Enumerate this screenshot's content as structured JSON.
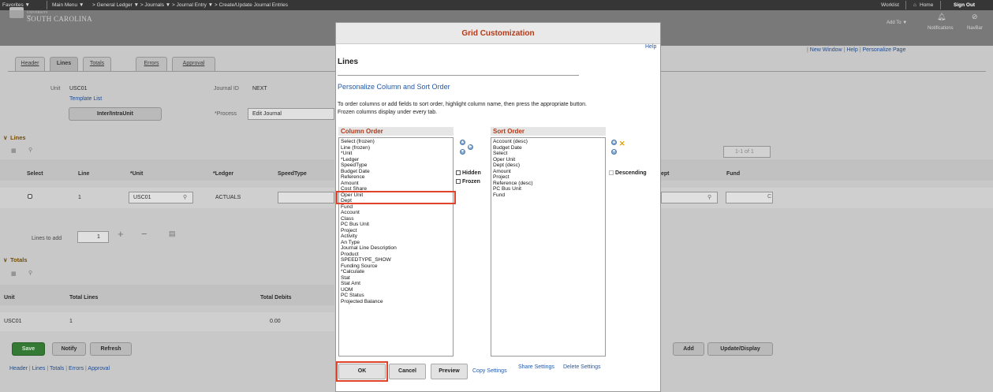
{
  "topbar": {
    "favorites": "Favorites ▼",
    "main_menu": "Main Menu ▼",
    "crumbs": "> General Ledger ▼ > Journals ▼ > Journal Entry ▼ > Create/Update Journal Entries",
    "worklist": "Worklist",
    "home": "Home",
    "signout": "Sign Out"
  },
  "header": {
    "logo_top": "UNIVERSITY OF",
    "logo_main": "SOUTH CAROLINA",
    "add_to": "Add To ▼",
    "notifications": "Notifications",
    "navbar": "NavBar",
    "links": [
      "New Window",
      "Help",
      "Personalize Page"
    ]
  },
  "tabs": [
    "Header",
    "Lines",
    "Totals",
    "Errors",
    "Approval"
  ],
  "form": {
    "unit_label": "Unit",
    "unit_value": "USC01",
    "template_list": "Template List",
    "interunit_btn": "Inter/IntraUnit",
    "journal_id_label": "Journal ID",
    "journal_id_value": "NEXT",
    "process_label": "*Process",
    "process_value": "Edit Journal"
  },
  "lines": {
    "section": "Lines",
    "pager": "1-1 of 1",
    "columns": [
      "Select",
      "Line",
      "*Unit",
      "*Ledger",
      "SpeedType"
    ],
    "right_columns": [
      "ept",
      "Fund"
    ],
    "row": {
      "line": "1",
      "unit": "USC01",
      "ledger": "ACTUALS"
    },
    "lines_to_add_label": "Lines to add",
    "lines_to_add_value": "1"
  },
  "totals": {
    "section": "Totals",
    "columns": [
      "Unit",
      "Total Lines",
      "Total Debits"
    ],
    "row": {
      "unit": "USC01",
      "lines": "1",
      "debits": "0.00"
    }
  },
  "bottom_buttons": [
    "Save",
    "Notify",
    "Refresh"
  ],
  "right_buttons": [
    "Add",
    "Update/Display"
  ],
  "bottom_links": [
    "Header",
    "Lines",
    "Totals",
    "Errors",
    "Approval"
  ],
  "modal": {
    "title": "Grid Customization",
    "help": "Help",
    "heading": "Lines",
    "subheading": "Personalize Column and Sort Order",
    "instructions_1": "To order columns or add fields to sort order, highlight column name, then press the appropriate button.",
    "instructions_2": "Frozen columns display under every tab.",
    "column_order_label": "Column Order",
    "sort_order_label": "Sort Order",
    "column_order_items": [
      "Select (frozen)",
      "Line (frozen)",
      "*Unit",
      "*Ledger",
      "SpeedType",
      "Budget Date",
      "Reference",
      "Amount",
      "Cost Share",
      "Oper Unit",
      "Dept",
      "Fund",
      "Account",
      "Class",
      "PC Bus Unit",
      "Project",
      "Activity",
      "An Type",
      "Journal Line Description",
      "Product",
      "SPEEDTYPE_SHOW",
      "Funding Source",
      "*Calculate",
      "Stat",
      "Stat Amt",
      "UOM",
      "PC Status",
      "Projected Balance"
    ],
    "sort_order_items": [
      "Account (desc)",
      "Budget Date",
      "Select",
      "Oper Unit",
      "Dept (desc)",
      "Amount",
      "Project",
      "Reference (desc)",
      "PC Bus Unit",
      "Fund"
    ],
    "hidden_label": "Hidden",
    "frozen_label": "Frozen",
    "descending_label": "Descending",
    "ok": "OK",
    "cancel": "Cancel",
    "preview": "Preview",
    "copy_settings": "Copy Settings",
    "share_settings": "Share Settings",
    "delete_settings": "Delete Settings"
  }
}
